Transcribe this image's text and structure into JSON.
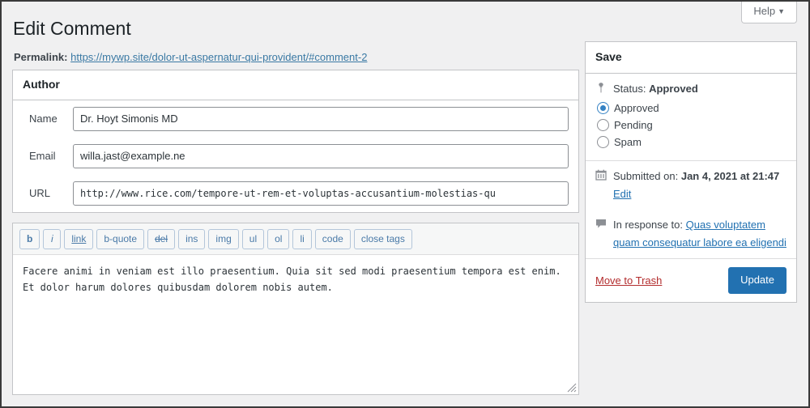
{
  "header": {
    "help_tab_label": "Help",
    "help_caret": "▼",
    "page_title": "Edit Comment"
  },
  "permalink": {
    "label": "Permalink:",
    "url_text": "https://mywp.site/dolor-ut-aspernatur-qui-provident/#comment-2"
  },
  "author_box": {
    "title": "Author",
    "fields": [
      {
        "label": "Name",
        "value": "Dr. Hoyt Simonis MD"
      },
      {
        "label": "Email",
        "value": "willa.jast@example.ne"
      },
      {
        "label": "URL",
        "value": "http://www.rice.com/tempore-ut-rem-et-voluptas-accusantium-molestias-qu"
      }
    ]
  },
  "editor": {
    "toolbar_buttons": [
      {
        "label": "b",
        "style": "b"
      },
      {
        "label": "i",
        "style": "i"
      },
      {
        "label": "link",
        "style": "u"
      },
      {
        "label": "b-quote",
        "style": ""
      },
      {
        "label": "del",
        "style": "s"
      },
      {
        "label": "ins",
        "style": ""
      },
      {
        "label": "img",
        "style": ""
      },
      {
        "label": "ul",
        "style": ""
      },
      {
        "label": "ol",
        "style": ""
      },
      {
        "label": "li",
        "style": ""
      },
      {
        "label": "code",
        "style": ""
      },
      {
        "label": "close tags",
        "style": ""
      }
    ],
    "content": "Facere animi in veniam est illo praesentium. Quia sit sed modi praesentium tempora est enim. Et dolor harum dolores quibusdam dolorem nobis autem."
  },
  "save_box": {
    "title": "Save",
    "status_icon": "pin-icon",
    "status_prefix": "Status:",
    "status_value": "Approved",
    "radios": [
      {
        "label": "Approved",
        "checked": true
      },
      {
        "label": "Pending",
        "checked": false
      },
      {
        "label": "Spam",
        "checked": false
      }
    ],
    "submitted_icon": "calendar-icon",
    "submitted_prefix": "Submitted on:",
    "submitted_value": "Jan 4, 2021 at 21:47",
    "submitted_edit_label": "Edit",
    "response_icon": "comment-bubble-icon",
    "response_prefix": "In response to:",
    "response_link_text": "Quas voluptatem quam consequatur labore ea eligendi",
    "trash_label": "Move to Trash",
    "update_label": "Update"
  },
  "colors": {
    "accent_blue": "#2271b1",
    "radio_blue": "#3582c4",
    "link_blue": "#3a79a4",
    "trash_red": "#b32d2e",
    "page_bg": "#f0f0f1",
    "panel_border": "#c3c4c7"
  }
}
